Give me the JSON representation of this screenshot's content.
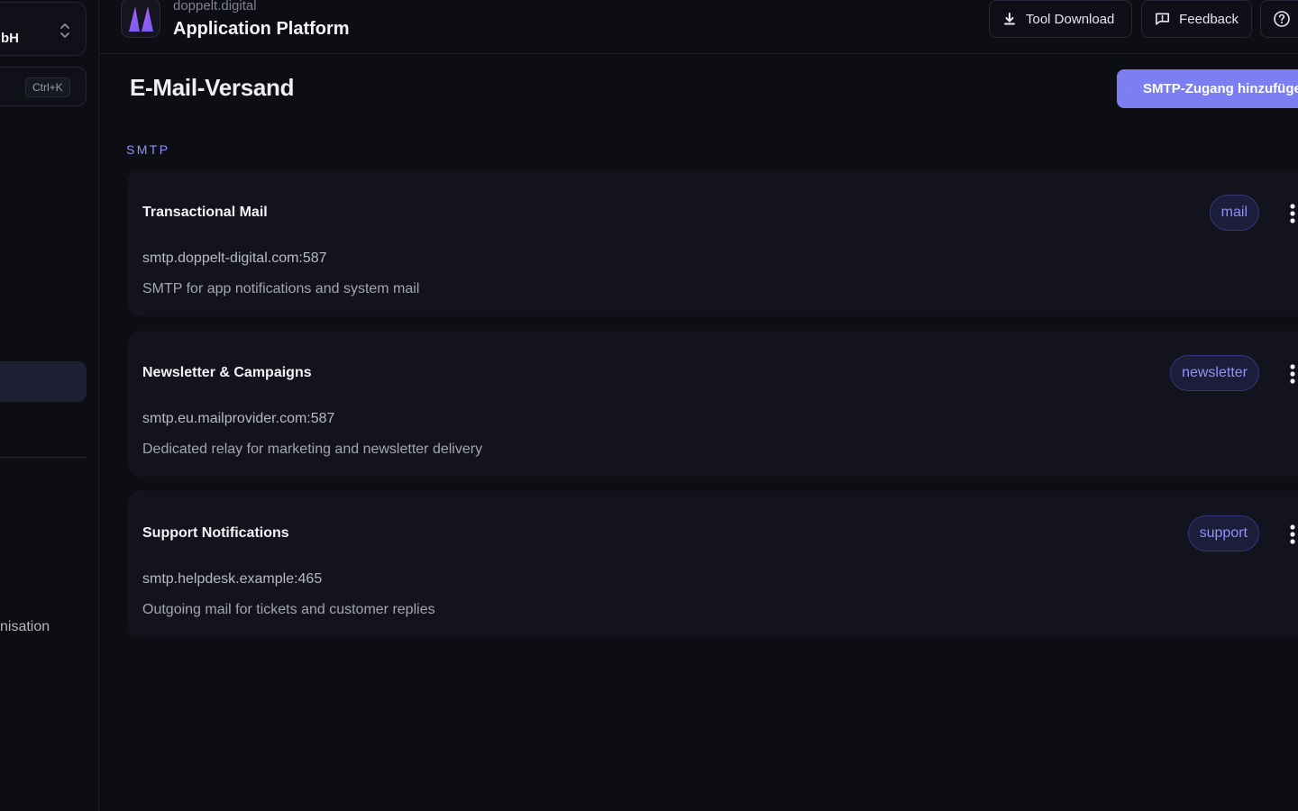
{
  "sidebar": {
    "org_name": "bH",
    "search_shortcut": "Ctrl+K",
    "nav_org_label": "nisation"
  },
  "header": {
    "brand_small": "doppelt.digital",
    "brand_title": "Application Platform",
    "tool_download": "Tool Download",
    "feedback": "Feedback"
  },
  "main": {
    "page_title": "E-Mail-Versand",
    "add_button": "SMTP-Zugang hinzufügen",
    "section_label": "SMTP",
    "accounts": [
      {
        "title": "Transactional Mail",
        "host": "smtp.doppelt-digital.com:587",
        "description": "SMTP for app notifications and system mail",
        "tag": "mail"
      },
      {
        "title": "Newsletter & Campaigns",
        "host": "smtp.eu.mailprovider.com:587",
        "description": "Dedicated relay for marketing and newsletter delivery",
        "tag": "newsletter"
      },
      {
        "title": "Support Notifications",
        "host": "smtp.helpdesk.example:465",
        "description": "Outgoing mail for tickets and customer replies",
        "tag": "support"
      }
    ]
  },
  "colors": {
    "background": "#0d0e14",
    "card": "#12131c",
    "accent": "#7c7ff2",
    "tag_text": "#8f93f5"
  },
  "icons": {
    "org_switcher": "chevron-up-down-icon",
    "download": "download-icon",
    "feedback": "feedback-icon",
    "help": "help-circle-icon",
    "add": "plus-icon",
    "card_menu": "kebab-menu-icon",
    "logo": "doppelt-logo-icon"
  }
}
